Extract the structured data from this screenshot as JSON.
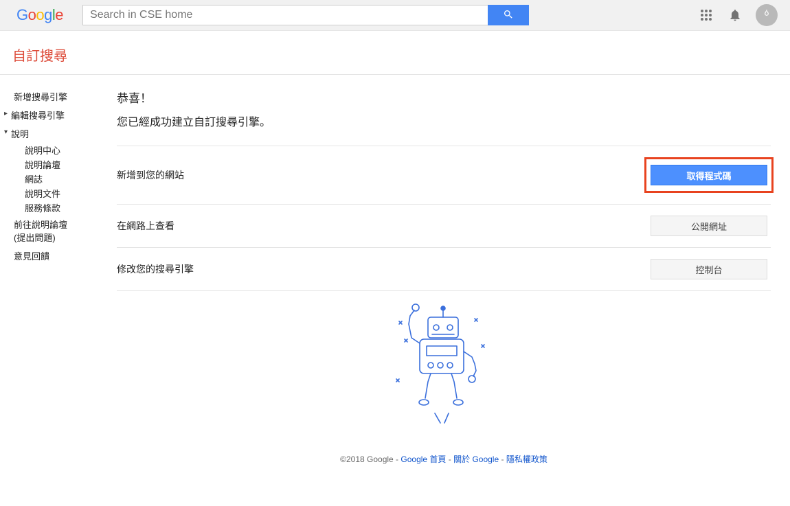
{
  "header": {
    "search_placeholder": "Search in CSE home"
  },
  "page_title": "自訂搜尋",
  "sidebar": {
    "new_engine": "新增搜尋引擎",
    "edit_engine": "編輯搜尋引擎",
    "help": "說明",
    "help_items": {
      "help_center": "說明中心",
      "help_forum": "說明論壇",
      "blog": "網誌",
      "docs": "說明文件",
      "tos": "服務條款"
    },
    "go_forum": "前往說明論壇",
    "go_forum_sub": "(提出問題)",
    "feedback": "意見回饋"
  },
  "main": {
    "congrats": "恭喜！",
    "success": "您已經成功建立自訂搜尋引擎。",
    "rows": {
      "add_to_site": {
        "label": "新增到您的網站",
        "button": "取得程式碼"
      },
      "view_online": {
        "label": "在網路上查看",
        "button": "公開網址"
      },
      "modify": {
        "label": "修改您的搜尋引擎",
        "button": "控制台"
      }
    }
  },
  "footer": {
    "copyright": "©2018 Google  - ",
    "links": {
      "home": "Google 首頁",
      "about": "關於 Google",
      "privacy": "隱私權政策"
    },
    "sep": " - "
  }
}
